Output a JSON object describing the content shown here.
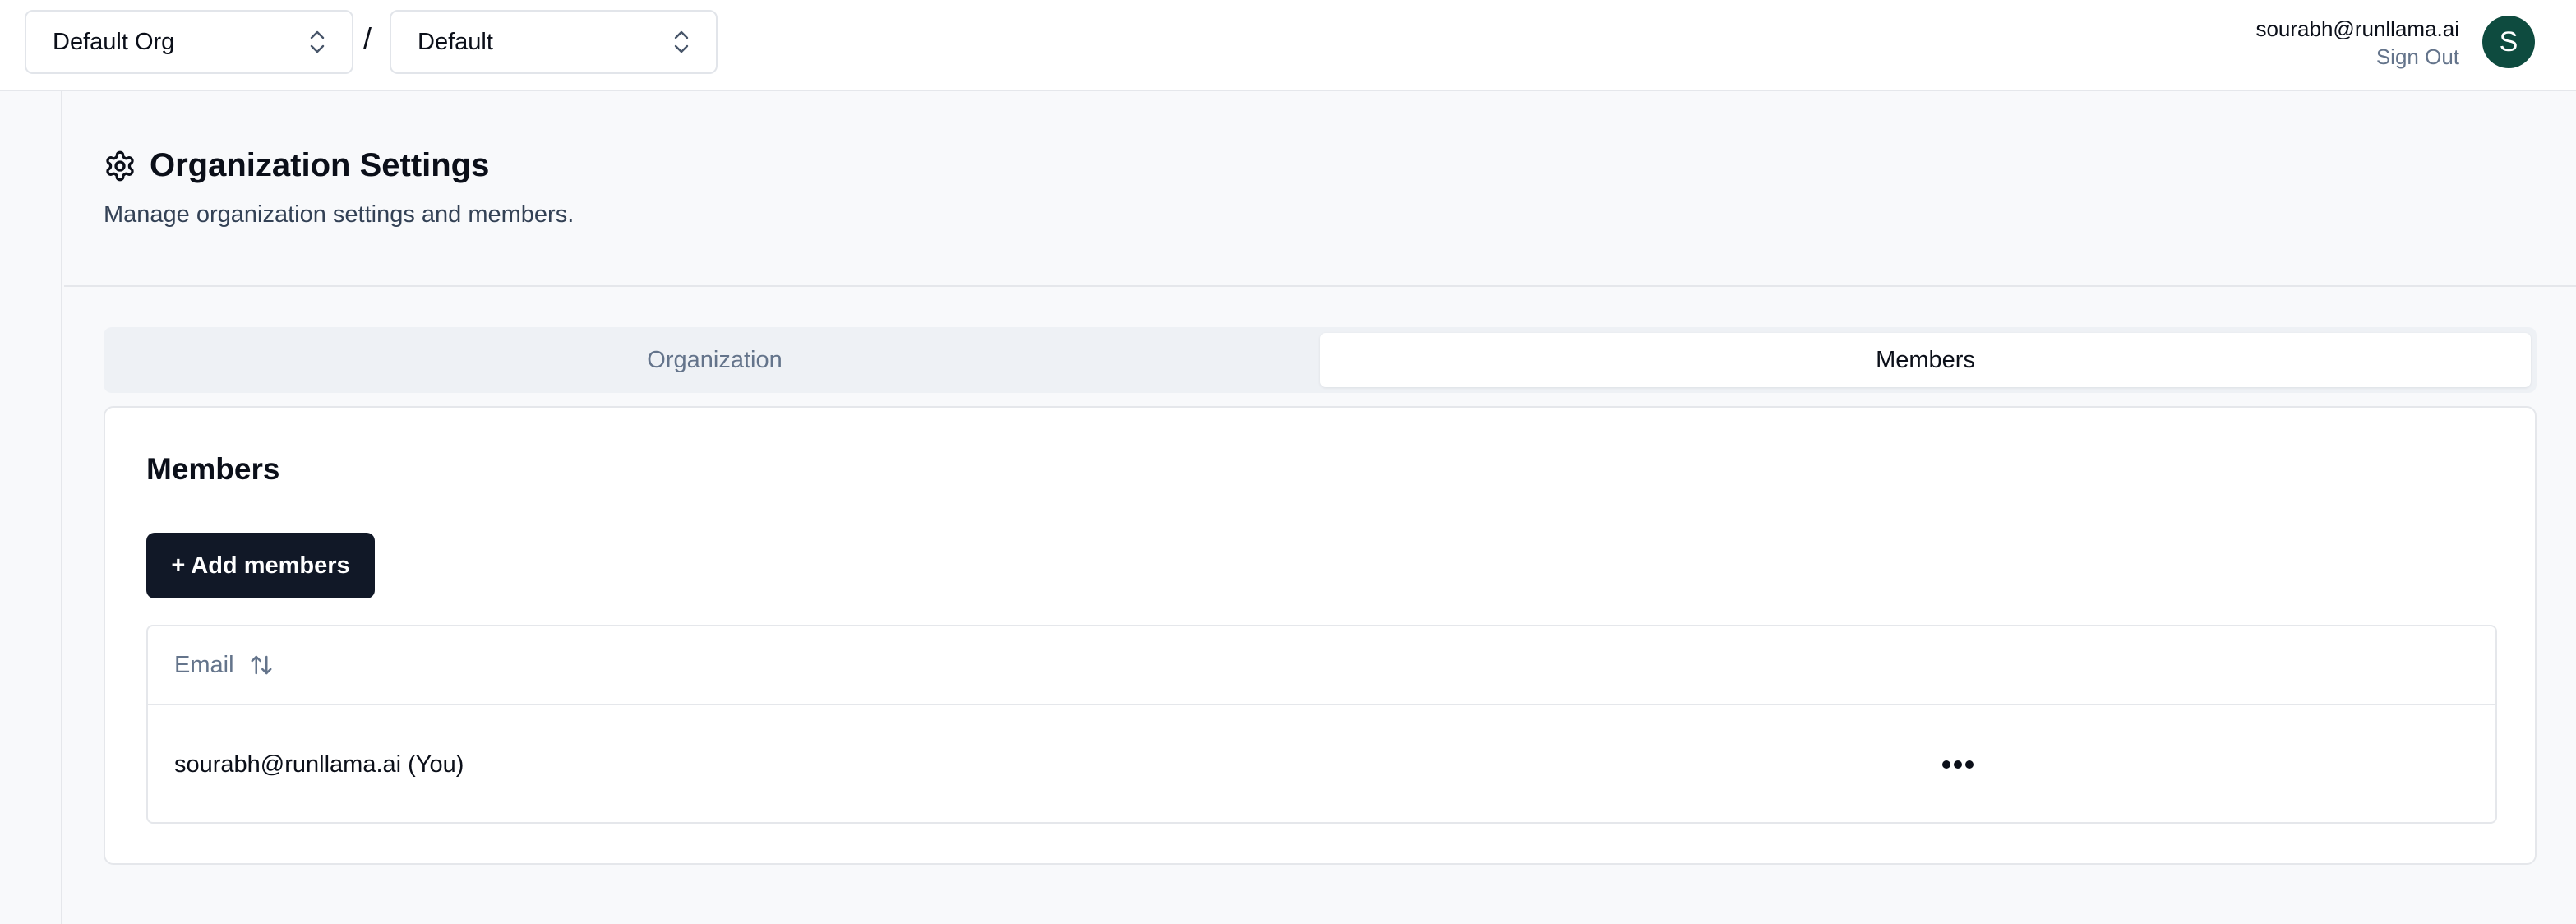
{
  "topbar": {
    "org_selector": {
      "value": "Default Org"
    },
    "separator": "/",
    "project_selector": {
      "value": "Default"
    },
    "user": {
      "email": "sourabh@runllama.ai",
      "sign_out_label": "Sign Out",
      "avatar_initial": "S",
      "avatar_color": "#0e4b3f"
    }
  },
  "header": {
    "title": "Organization Settings",
    "subtitle": "Manage organization settings and members.",
    "icon": "gear-icon"
  },
  "tabs": [
    {
      "label": "Organization",
      "active": false
    },
    {
      "label": "Members",
      "active": true
    }
  ],
  "members": {
    "title": "Members",
    "add_button_label": "+ Add members",
    "table": {
      "columns": [
        {
          "label": "Email",
          "sortable": true
        }
      ],
      "rows": [
        {
          "email": "sourabh@runllama.ai (You)",
          "actions_icon": "more-horizontal-icon"
        }
      ]
    }
  },
  "colors": {
    "primary_button": "#111827",
    "page_background": "#f8f9fb",
    "muted_text": "#64748b"
  }
}
